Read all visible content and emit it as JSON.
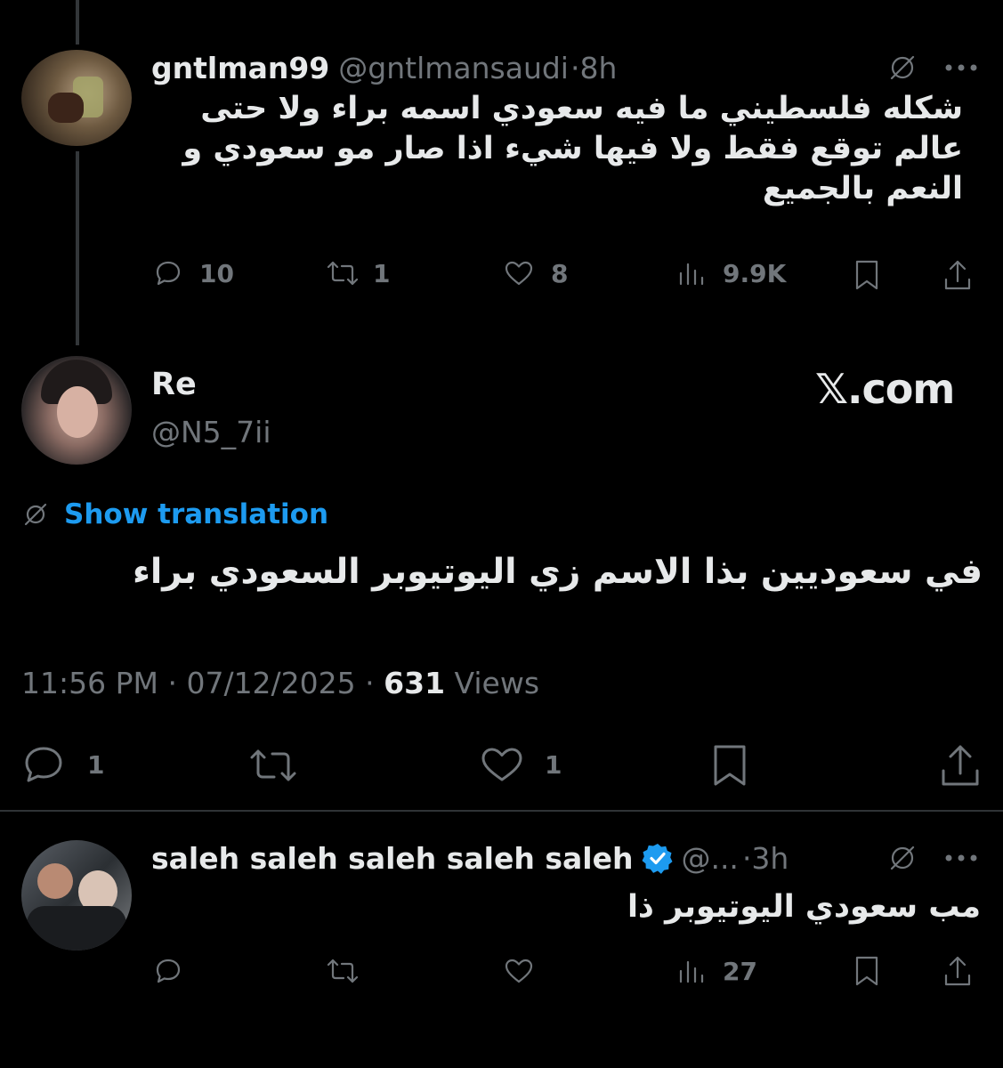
{
  "thread_line": {
    "color": "#333639"
  },
  "parent_tweet": {
    "display_name": "gntlman99",
    "handle": "@gntlmansaudi",
    "time": "·8h",
    "text": "شكله فلسطيني ما فيه سعودي اسمه براء ولا حتى عالم توقع فقط ولا فيها شيء اذا صار مو سعودي و النعم بالجميع",
    "actions": {
      "replies": "10",
      "reposts": "1",
      "likes": "8",
      "views": "9.9K"
    }
  },
  "main_tweet": {
    "display_name": "Re",
    "handle": "@N5_7ii",
    "brand": "𝕏.com",
    "show_translation": "Show translation",
    "text": "في سعوديين بذا الاسم زي اليوتيوبر السعودي براء",
    "time": "11:56 PM",
    "date": "07/12/2025",
    "views_count": "631",
    "views_label": "Views",
    "actions": {
      "replies": "1",
      "likes": "1"
    }
  },
  "reply_tweet": {
    "display_name": "saleh saleh saleh saleh saleh",
    "handle": "@...",
    "time": "·3h",
    "text": "مب سعودي اليوتيوبر ذا",
    "actions": {
      "views": "27"
    }
  },
  "colors": {
    "accent": "#1d9bf0",
    "muted": "#71767b",
    "text": "#e7e9ea",
    "background": "#000000"
  }
}
